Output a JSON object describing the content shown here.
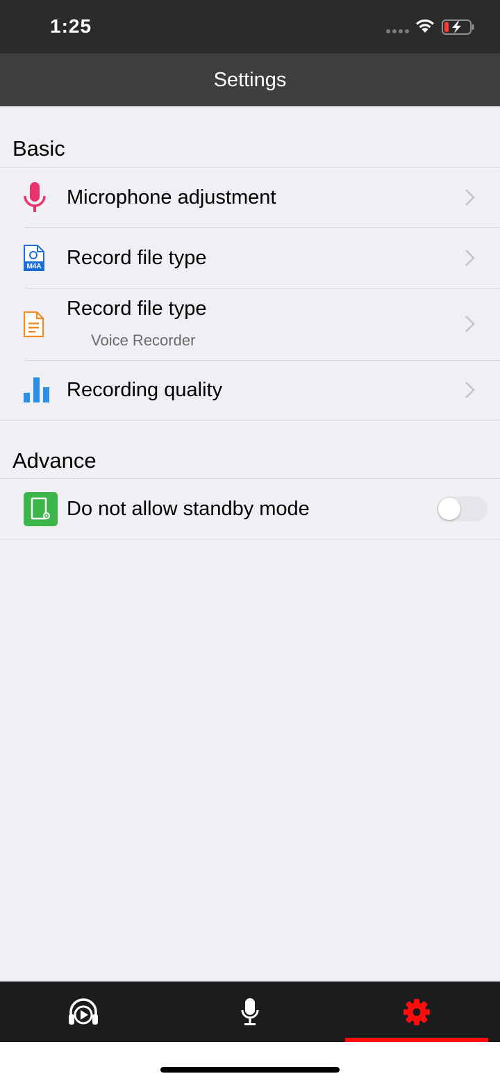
{
  "status_bar": {
    "time": "1:25",
    "icons": [
      "cellular-signal-icon",
      "wifi-icon",
      "battery-charging-icon"
    ]
  },
  "navbar": {
    "title": "Settings"
  },
  "sections": {
    "basic": {
      "header": "Basic",
      "rows": [
        {
          "label": "Microphone adjustment",
          "icon": "microphone-icon",
          "icon_color": "#e8336d"
        },
        {
          "label": "Record file type",
          "icon": "m4a-file-icon",
          "icon_color": "#1d6fd6"
        },
        {
          "label": "Record file type",
          "sublabel": "Voice Recorder",
          "icon": "document-icon",
          "icon_color": "#f08a24"
        },
        {
          "label": "Recording quality",
          "icon": "bar-chart-icon",
          "icon_color": "#2b8fe8"
        }
      ]
    },
    "advance": {
      "header": "Advance",
      "rows": [
        {
          "label": "Do not allow standby mode",
          "icon": "standby-screen-icon",
          "icon_color": "#3cb54a",
          "toggle_on": false
        }
      ]
    }
  },
  "tabbar": {
    "tabs": [
      {
        "name": "player",
        "icon": "headphones-play-icon"
      },
      {
        "name": "record",
        "icon": "microphone-icon"
      },
      {
        "name": "settings",
        "icon": "gear-icon",
        "active": true
      }
    ],
    "active_color": "#ff0d0d",
    "m4a_badge": "M4A"
  }
}
